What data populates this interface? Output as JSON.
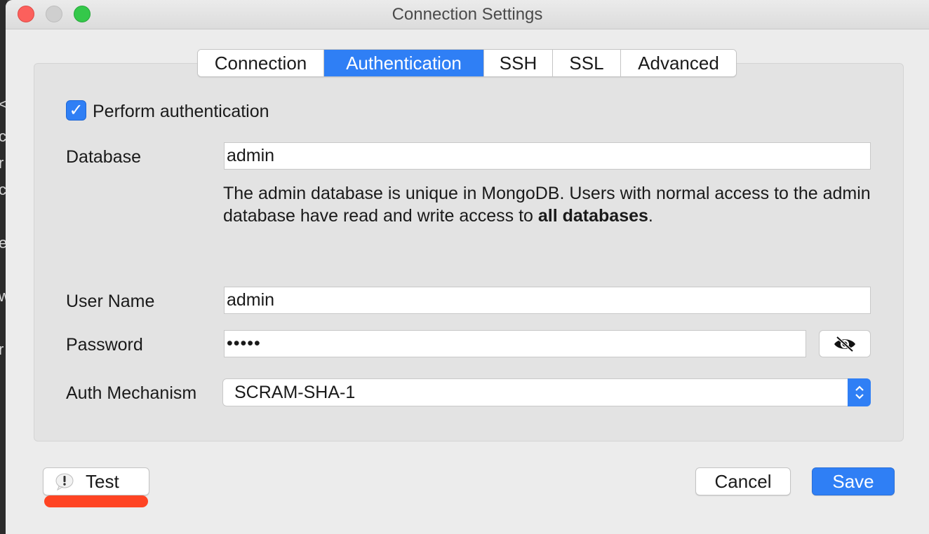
{
  "window": {
    "title": "Connection Settings"
  },
  "tabs": [
    {
      "label": "Connection",
      "active": false
    },
    {
      "label": "Authentication",
      "active": true
    },
    {
      "label": "SSH",
      "active": false
    },
    {
      "label": "SSL",
      "active": false
    },
    {
      "label": "Advanced",
      "active": false
    }
  ],
  "auth": {
    "perform_label": "Perform authentication",
    "perform_checked": true,
    "database_label": "Database",
    "database_value": "admin",
    "desc_part1": "The admin database is unique in MongoDB. Users with normal access to the admin database have read and write access to ",
    "desc_bold": "all databases",
    "desc_part2": ".",
    "username_label": "User Name",
    "username_value": "admin",
    "password_label": "Password",
    "password_value": "•••••",
    "mechanism_label": "Auth Mechanism",
    "mechanism_value": "SCRAM-SHA-1"
  },
  "footer": {
    "test_label": "Test",
    "cancel_label": "Cancel",
    "save_label": "Save"
  },
  "colors": {
    "accent": "#2f7ff5",
    "annotation": "#ff4423"
  },
  "background": {
    "edge_glyphs": [
      "<",
      "c",
      "r",
      "c",
      "e",
      "w",
      "r"
    ]
  }
}
